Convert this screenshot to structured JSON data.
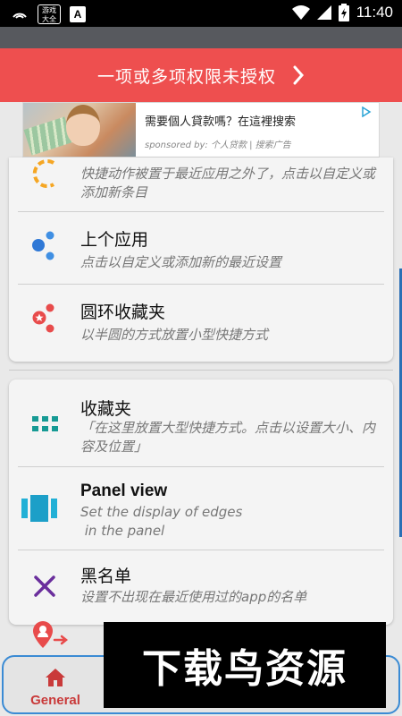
{
  "status_bar": {
    "time": "11:40",
    "badge_text": "游戏\n大全",
    "a_badge": "A"
  },
  "warning_banner": {
    "text": "一项或多项权限未授权"
  },
  "ad": {
    "title": "需要個人貸款嗎？在這裡搜索",
    "sponsor": "sponsored by: 个人贷款 | 搜索广告"
  },
  "card1": {
    "rows": [
      {
        "title": "",
        "subtitle": "快捷动作被置于最近应用之外了，点击以自定义或添加新条目"
      },
      {
        "title": "上个应用",
        "subtitle": "点击以自定义或添加新的最近设置"
      },
      {
        "title": "圆环收藏夹",
        "subtitle": "以半圆的方式放置小型快捷方式"
      }
    ]
  },
  "card2": {
    "rows": [
      {
        "title": "收藏夹",
        "subtitle": "「在这里放置大型快捷方式。点击以设置大小、内容及位置」"
      },
      {
        "title": "Panel view",
        "subtitle": "Set the display of edges\n in the panel"
      },
      {
        "title": "黑名单",
        "subtitle": "设置不出现在最近使用过的app的名单"
      }
    ]
  },
  "bottom_nav": {
    "general_label": "General"
  },
  "watermark": {
    "text": "下载鸟资源"
  },
  "colors": {
    "banner": "#ee4f4f",
    "accent_blue": "#2f8fd1",
    "accent_red": "#e84b4b",
    "teal": "#169a94",
    "purple": "#6a2e9c",
    "orange": "#f5a623"
  }
}
